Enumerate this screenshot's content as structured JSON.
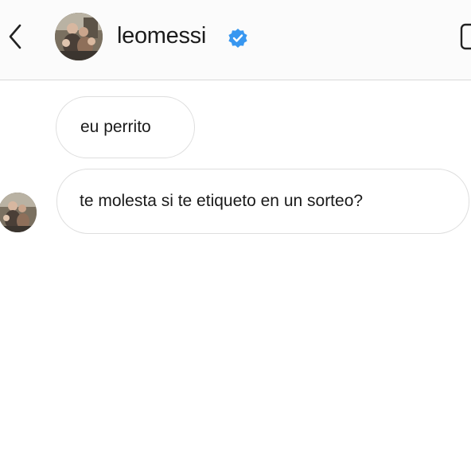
{
  "header": {
    "username": "leomessi",
    "verified": true,
    "accent_color": "#3897f0"
  },
  "icons": {
    "back": "chevron-left-icon",
    "verified": "verified-badge-icon",
    "info": "info-icon"
  },
  "messages": [
    {
      "sender": "self",
      "text": "eu perrito"
    },
    {
      "sender": "leomessi",
      "text": "te molesta si te etiqueto en un sorteo?",
      "show_avatar": true
    }
  ]
}
